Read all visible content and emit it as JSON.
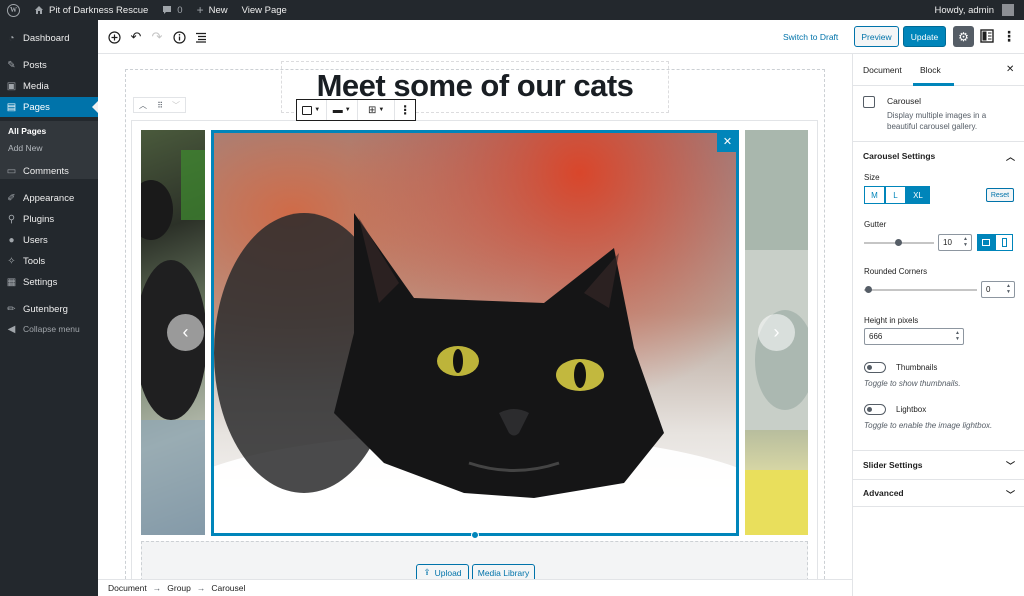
{
  "adminbar": {
    "site_name": "Pit of Darkness Rescue",
    "comments_count": "0",
    "new_label": "New",
    "view_page_label": "View Page",
    "greeting": "Howdy, admin"
  },
  "sidebar": {
    "items": [
      {
        "label": "Dashboard",
        "icon": "dashboard-icon"
      },
      {
        "label": "Posts",
        "icon": "pin-icon"
      },
      {
        "label": "Media",
        "icon": "media-icon"
      },
      {
        "label": "Pages",
        "icon": "page-icon"
      },
      {
        "label": "Comments",
        "icon": "comment-icon"
      },
      {
        "label": "Appearance",
        "icon": "brush-icon"
      },
      {
        "label": "Plugins",
        "icon": "plugin-icon"
      },
      {
        "label": "Users",
        "icon": "user-icon"
      },
      {
        "label": "Tools",
        "icon": "wrench-icon"
      },
      {
        "label": "Settings",
        "icon": "settings-icon"
      },
      {
        "label": "Gutenberg",
        "icon": "pencil-icon"
      }
    ],
    "submenu": {
      "all_pages": "All Pages",
      "add_new": "Add New"
    },
    "collapse_label": "Collapse menu"
  },
  "topbar": {
    "switch_draft": "Switch to Draft",
    "preview": "Preview",
    "update": "Update"
  },
  "editor": {
    "page_title": "Meet some of our cats",
    "upload_label": "Upload",
    "media_library_label": "Media Library"
  },
  "breadcrumb": [
    "Document",
    "Group",
    "Carousel"
  ],
  "panel": {
    "tab_document": "Document",
    "tab_block": "Block",
    "block_name": "Carousel",
    "block_description": "Display multiple images in a beautiful carousel gallery.",
    "carousel_settings_title": "Carousel Settings",
    "size_label": "Size",
    "size_options": [
      "M",
      "L",
      "XL"
    ],
    "size_selected": "XL",
    "reset_label": "Reset",
    "gutter_label": "Gutter",
    "gutter_value": "10",
    "rounded_corners_label": "Rounded Corners",
    "rounded_corners_value": "0",
    "height_label": "Height in pixels",
    "height_value": "666",
    "thumbnails_label": "Thumbnails",
    "thumbnails_help": "Toggle to show thumbnails.",
    "lightbox_label": "Lightbox",
    "lightbox_help": "Toggle to enable the image lightbox.",
    "slider_settings_title": "Slider Settings",
    "advanced_title": "Advanced"
  },
  "colors": {
    "admin_dark": "#23282d",
    "accent_blue": "#0085ba",
    "active_menu": "#0073aa"
  }
}
